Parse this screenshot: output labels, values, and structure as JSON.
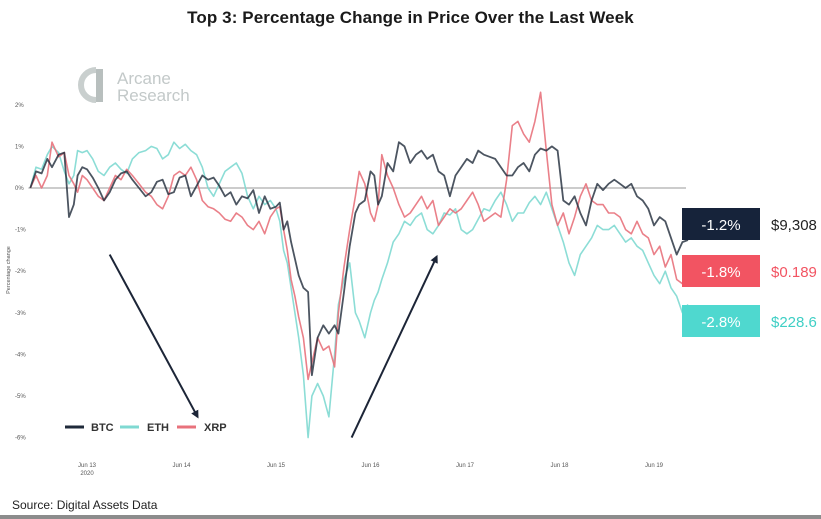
{
  "title": "Top 3: Percentage Change in Price Over the Last Week",
  "source": "Source: Digital Assets Data",
  "logo": {
    "line1": "Arcane",
    "line2": "Research",
    "icon": "arcane-a-logo-icon"
  },
  "colors": {
    "BTC": "#1f2a3a",
    "ETH": "#7fd9d2",
    "XRP": "#e8727c",
    "zero_line": "#9a9a9a",
    "arrow": "#1c2537"
  },
  "badges": [
    {
      "asset": "BTC",
      "change": "-1.2%",
      "price": "$9,308",
      "bg": "#16233a",
      "price_color": "#222222"
    },
    {
      "asset": "XRP",
      "change": "-1.8%",
      "price": "$0.189",
      "bg": "#f25462",
      "price_color": "#f25462"
    },
    {
      "asset": "ETH",
      "change": "-2.8%",
      "price": "$228.6",
      "bg": "#4fd8cf",
      "price_color": "#3fcfc5"
    }
  ],
  "chart_data": {
    "type": "line",
    "title": "Top 3: Percentage Change in Price Over the Last Week",
    "xlabel": "",
    "ylabel": "Percentage change",
    "ylim": [
      -6,
      2
    ],
    "yticks": [
      2,
      1,
      0,
      -1,
      -2,
      -3,
      -4,
      -5,
      -6
    ],
    "ytick_labels": [
      "2%",
      "1%",
      "0%",
      "-1%",
      "-2%",
      "-3%",
      "-4%",
      "-5%",
      "-6%"
    ],
    "xlim": [
      12.38,
      19.75
    ],
    "xticks": [
      13,
      14,
      15,
      16,
      17,
      18,
      19
    ],
    "xtick_labels": [
      "Jun 13",
      "Jun 14",
      "Jun 15",
      "Jun 16",
      "Jun 17",
      "Jun 18",
      "Jun 19"
    ],
    "xtick_sublabel": "2020",
    "grid": false,
    "zero_line": true,
    "legend": {
      "placement": "bottom-left",
      "entries": [
        "BTC",
        "ETH",
        "XRP"
      ]
    },
    "annotations": [
      {
        "type": "arrow",
        "direction": "down",
        "from": [
          13.24,
          -1.6
        ],
        "to": [
          14.17,
          -5.5
        ]
      },
      {
        "type": "arrow",
        "direction": "up",
        "from": [
          15.8,
          -6.0
        ],
        "to": [
          16.7,
          -1.65
        ]
      }
    ],
    "series": [
      {
        "name": "BTC",
        "x": [
          12.4,
          12.46,
          12.52,
          12.58,
          12.63,
          12.7,
          12.76,
          12.81,
          12.86,
          12.9,
          12.95,
          13.0,
          13.06,
          13.12,
          13.18,
          13.24,
          13.3,
          13.36,
          13.42,
          13.48,
          13.55,
          13.62,
          13.68,
          13.74,
          13.8,
          13.86,
          13.92,
          13.98,
          14.04,
          14.1,
          14.16,
          14.22,
          14.28,
          14.34,
          14.4,
          14.46,
          14.52,
          14.58,
          14.64,
          14.7,
          14.76,
          14.82,
          14.88,
          14.94,
          15.0,
          15.04,
          15.08,
          15.12,
          15.16,
          15.2,
          15.24,
          15.29,
          15.34,
          15.38,
          15.44,
          15.5,
          15.56,
          15.62,
          15.66,
          15.72,
          15.78,
          15.84,
          15.88,
          15.94,
          16.0,
          16.04,
          16.08,
          16.12,
          16.18,
          16.24,
          16.3,
          16.36,
          16.42,
          16.48,
          16.54,
          16.6,
          16.66,
          16.72,
          16.78,
          16.84,
          16.9,
          16.96,
          17.02,
          17.08,
          17.14,
          17.2,
          17.26,
          17.32,
          17.38,
          17.44,
          17.5,
          17.56,
          17.62,
          17.68,
          17.74,
          17.8,
          17.86,
          17.92,
          17.98,
          18.04,
          18.1,
          18.16,
          18.22,
          18.28,
          18.34,
          18.4,
          18.46,
          18.52,
          18.58,
          18.64,
          18.7,
          18.76,
          18.82,
          18.88,
          18.94,
          19.0,
          19.06,
          19.12,
          19.18,
          19.24,
          19.3,
          19.36
        ],
        "values": [
          0.0,
          0.4,
          0.35,
          0.7,
          0.5,
          0.8,
          0.85,
          -0.7,
          -0.4,
          0.3,
          0.5,
          0.45,
          0.25,
          0.0,
          -0.3,
          -0.1,
          0.2,
          0.35,
          0.4,
          0.2,
          0.0,
          -0.2,
          -0.1,
          0.15,
          0.2,
          -0.15,
          -0.1,
          0.25,
          0.3,
          -0.2,
          0.05,
          0.3,
          0.2,
          0.25,
          0.05,
          -0.2,
          -0.1,
          -0.4,
          -0.2,
          -0.25,
          -0.05,
          -0.6,
          -0.2,
          -0.5,
          -0.45,
          -0.35,
          -1.0,
          -0.8,
          -1.3,
          -1.7,
          -2.1,
          -2.4,
          -2.5,
          -4.5,
          -3.6,
          -3.3,
          -3.5,
          -3.3,
          -3.5,
          -2.5,
          -1.4,
          -0.6,
          -0.4,
          -0.3,
          0.4,
          0.3,
          -0.4,
          -0.2,
          0.6,
          0.4,
          1.1,
          1.0,
          0.6,
          0.8,
          0.9,
          0.7,
          0.8,
          0.4,
          0.3,
          -0.2,
          0.3,
          0.5,
          0.7,
          0.6,
          0.9,
          0.8,
          0.75,
          0.7,
          0.5,
          0.3,
          0.3,
          0.5,
          0.6,
          0.4,
          0.8,
          0.95,
          0.9,
          1.0,
          0.9,
          -0.3,
          -0.4,
          -0.2,
          -0.6,
          -0.9,
          -0.3,
          0.1,
          -0.05,
          0.1,
          0.2,
          0.1,
          0.0,
          0.1,
          -0.2,
          -0.3,
          -0.5,
          -0.9,
          -0.7,
          -0.8,
          -1.2,
          -1.6,
          -1.3,
          -1.25
        ],
        "last_change": -1.2,
        "last_price": "$9,308"
      },
      {
        "name": "ETH",
        "x": [
          12.4,
          12.46,
          12.52,
          12.58,
          12.63,
          12.7,
          12.76,
          12.81,
          12.86,
          12.9,
          12.95,
          13.0,
          13.06,
          13.12,
          13.18,
          13.24,
          13.3,
          13.36,
          13.42,
          13.48,
          13.55,
          13.62,
          13.68,
          13.74,
          13.8,
          13.86,
          13.92,
          13.98,
          14.04,
          14.1,
          14.16,
          14.22,
          14.28,
          14.34,
          14.4,
          14.46,
          14.52,
          14.58,
          14.64,
          14.7,
          14.76,
          14.82,
          14.88,
          14.94,
          15.0,
          15.04,
          15.08,
          15.12,
          15.16,
          15.2,
          15.24,
          15.29,
          15.34,
          15.38,
          15.44,
          15.5,
          15.56,
          15.62,
          15.66,
          15.72,
          15.78,
          15.84,
          15.88,
          15.94,
          16.0,
          16.04,
          16.08,
          16.12,
          16.18,
          16.24,
          16.3,
          16.36,
          16.42,
          16.48,
          16.54,
          16.6,
          16.66,
          16.72,
          16.78,
          16.84,
          16.9,
          16.96,
          17.02,
          17.08,
          17.14,
          17.2,
          17.26,
          17.32,
          17.38,
          17.44,
          17.5,
          17.56,
          17.62,
          17.68,
          17.74,
          17.8,
          17.86,
          17.92,
          17.98,
          18.04,
          18.1,
          18.16,
          18.22,
          18.28,
          18.34,
          18.4,
          18.46,
          18.52,
          18.58,
          18.64,
          18.7,
          18.76,
          18.82,
          18.88,
          18.94,
          19.0,
          19.06,
          19.12,
          19.18,
          19.24,
          19.3,
          19.36
        ],
        "values": [
          0.0,
          0.5,
          0.45,
          0.8,
          1.0,
          0.85,
          0.4,
          0.1,
          0.3,
          0.9,
          0.85,
          0.9,
          0.7,
          0.4,
          0.3,
          0.5,
          0.6,
          0.45,
          0.35,
          0.7,
          0.85,
          0.9,
          1.0,
          0.95,
          0.7,
          0.8,
          1.1,
          0.95,
          1.05,
          0.9,
          0.8,
          0.5,
          0.0,
          -0.2,
          0.1,
          0.4,
          0.5,
          0.6,
          0.35,
          -0.2,
          -0.5,
          -0.2,
          -0.4,
          -0.3,
          -0.5,
          -0.8,
          -1.5,
          -1.8,
          -2.4,
          -3.0,
          -3.6,
          -4.5,
          -6.0,
          -5.0,
          -4.7,
          -5.0,
          -5.5,
          -4.0,
          -2.8,
          -2.2,
          -1.8,
          -3.0,
          -3.2,
          -3.6,
          -3.0,
          -2.7,
          -2.5,
          -2.2,
          -1.8,
          -1.3,
          -1.1,
          -0.8,
          -0.9,
          -0.7,
          -0.6,
          -1.0,
          -1.1,
          -0.9,
          -0.6,
          -0.65,
          -0.5,
          -1.0,
          -1.1,
          -1.0,
          -0.75,
          -0.5,
          -0.55,
          -0.3,
          -0.1,
          -0.4,
          -0.8,
          -0.6,
          -0.6,
          -0.35,
          -0.2,
          -0.4,
          -0.1,
          -0.5,
          -0.9,
          -1.3,
          -1.8,
          -2.1,
          -1.6,
          -1.4,
          -1.2,
          -0.9,
          -1.0,
          -1.0,
          -0.9,
          -1.1,
          -1.3,
          -1.2,
          -1.4,
          -1.5,
          -1.8,
          -2.1,
          -2.3,
          -2.0,
          -2.4,
          -2.6,
          -3.0,
          -2.8
        ],
        "last_change": -2.8,
        "last_price": "$228.6"
      },
      {
        "name": "XRP",
        "x": [
          12.4,
          12.46,
          12.52,
          12.58,
          12.63,
          12.7,
          12.76,
          12.81,
          12.86,
          12.9,
          12.95,
          13.0,
          13.06,
          13.12,
          13.18,
          13.24,
          13.3,
          13.36,
          13.42,
          13.48,
          13.55,
          13.62,
          13.68,
          13.74,
          13.8,
          13.86,
          13.92,
          13.98,
          14.04,
          14.1,
          14.16,
          14.22,
          14.28,
          14.34,
          14.4,
          14.46,
          14.52,
          14.58,
          14.64,
          14.7,
          14.76,
          14.82,
          14.88,
          14.94,
          15.0,
          15.04,
          15.08,
          15.12,
          15.16,
          15.2,
          15.24,
          15.29,
          15.34,
          15.38,
          15.44,
          15.5,
          15.56,
          15.62,
          15.66,
          15.72,
          15.78,
          15.84,
          15.88,
          15.94,
          16.0,
          16.04,
          16.08,
          16.12,
          16.18,
          16.24,
          16.3,
          16.36,
          16.42,
          16.48,
          16.54,
          16.6,
          16.66,
          16.72,
          16.78,
          16.84,
          16.9,
          16.96,
          17.02,
          17.08,
          17.14,
          17.2,
          17.26,
          17.32,
          17.38,
          17.44,
          17.5,
          17.56,
          17.62,
          17.68,
          17.74,
          17.8,
          17.86,
          17.92,
          17.98,
          18.04,
          18.1,
          18.16,
          18.22,
          18.28,
          18.34,
          18.4,
          18.46,
          18.52,
          18.58,
          18.64,
          18.7,
          18.76,
          18.82,
          18.88,
          18.94,
          19.0,
          19.06,
          19.12,
          19.18,
          19.24,
          19.3,
          19.36
        ],
        "values": [
          0.0,
          0.3,
          0.0,
          0.3,
          1.1,
          0.75,
          0.85,
          0.3,
          0.1,
          -0.1,
          0.3,
          0.2,
          0.0,
          -0.2,
          -0.3,
          0.0,
          0.3,
          0.2,
          0.45,
          0.3,
          0.1,
          -0.1,
          -0.2,
          -0.4,
          -0.5,
          -0.2,
          0.3,
          0.4,
          0.3,
          0.5,
          0.2,
          -0.3,
          -0.45,
          -0.5,
          -0.6,
          -0.75,
          -0.8,
          -0.6,
          -0.7,
          -0.9,
          -1.0,
          -0.8,
          -1.1,
          -0.7,
          -0.5,
          -0.45,
          -1.0,
          -1.5,
          -2.2,
          -2.6,
          -3.1,
          -3.6,
          -4.6,
          -4.2,
          -3.6,
          -3.9,
          -3.8,
          -4.3,
          -3.0,
          -1.9,
          -1.0,
          -0.2,
          0.4,
          0.1,
          -0.6,
          -0.8,
          -0.4,
          0.8,
          0.3,
          0.0,
          -0.4,
          -0.7,
          -0.6,
          -0.4,
          -0.2,
          -0.5,
          -0.3,
          -0.9,
          -0.7,
          -0.5,
          -0.6,
          -0.5,
          -0.3,
          -0.1,
          -0.4,
          -0.8,
          -0.7,
          -0.6,
          -0.7,
          0.2,
          1.5,
          1.6,
          1.3,
          1.1,
          1.6,
          2.3,
          0.9,
          -0.4,
          -0.9,
          -0.6,
          -1.1,
          -0.7,
          -0.2,
          0.1,
          -0.3,
          -0.4,
          -0.4,
          -0.6,
          -0.6,
          -0.7,
          -1.0,
          -1.1,
          -0.8,
          -1.1,
          -1.2,
          -1.6,
          -1.4,
          -1.9,
          -1.6,
          -2.2,
          -2.3,
          -1.9
        ],
        "last_change": -1.8,
        "last_price": "$0.189"
      }
    ]
  }
}
